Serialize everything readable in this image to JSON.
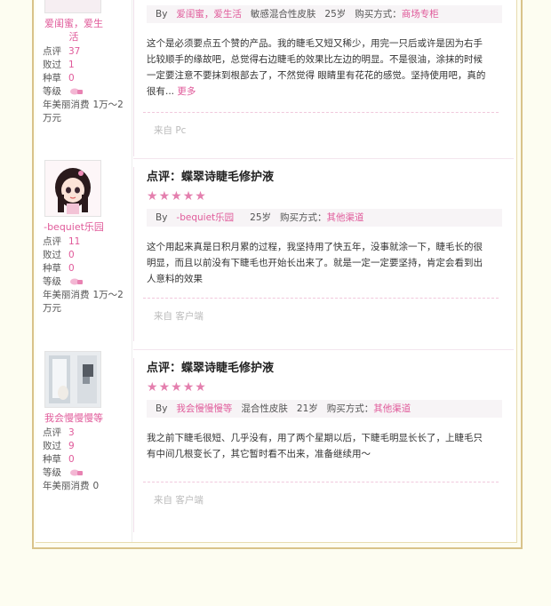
{
  "colors": {
    "accent": "#e05a9a",
    "frame": "#d9c38a",
    "star": "#e47fae"
  },
  "reviews": [
    {
      "username": "爱闺蜜，爱生活",
      "stats": {
        "points_label": "点评",
        "points": "37",
        "fail_label": "败过",
        "fail": "1",
        "grass_label": "种草",
        "grass": "0",
        "level_label": "等级",
        "spend_label": "年美丽消费",
        "spend": "1万～2万元"
      },
      "meta": {
        "by": "By",
        "user": "爱闺蜜，爱生活",
        "skin": "敏感混合性皮肤",
        "age": "25岁",
        "buy_label": "购买方式：",
        "buy": "商场专柜"
      },
      "body": "这个是必须要点五个赞的产品。我的睫毛又短又稀少，用完一只后或许是因为右手比较顺手的缘故吧，总觉得右边睫毛的效果比左边的明显。不是很油，涂抹的时候一定要注意不要抹到根部去了，不然觉得 眼睛里有花花的感觉。坚持使用吧，真的很有...",
      "more": "更多",
      "source": "来自 Pc"
    },
    {
      "username": "-bequiet乐园",
      "title": "点评：蝶翠诗睫毛修护液",
      "stats": {
        "points_label": "点评",
        "points": "11",
        "fail_label": "败过",
        "fail": "0",
        "grass_label": "种草",
        "grass": "0",
        "level_label": "等级",
        "spend_label": "年美丽消费",
        "spend": "1万～2万元"
      },
      "meta": {
        "by": "By",
        "user": "-bequiet乐园",
        "age": "25岁",
        "buy_label": "购买方式：",
        "buy": "其他渠道"
      },
      "body": "这个用起来真是日积月累的过程，我坚持用了快五年，没事就涂一下，睫毛长的很明显，而且以前没有下睫毛也开始长出来了。就是一定一定要坚持，肯定会看到出人意料的效果",
      "source": "来自 客户端"
    },
    {
      "username": "我会慢慢慢等",
      "title": "点评：蝶翠诗睫毛修护液",
      "stats": {
        "points_label": "点评",
        "points": "3",
        "fail_label": "败过",
        "fail": "9",
        "grass_label": "种草",
        "grass": "0",
        "level_label": "等级",
        "spend_label": "年美丽消费",
        "spend": "0"
      },
      "meta": {
        "by": "By",
        "user": "我会慢慢慢等",
        "skin": "混合性皮肤",
        "age": "21岁",
        "buy_label": "购买方式：",
        "buy": "其他渠道"
      },
      "body": "我之前下睫毛很短、几乎没有，用了两个星期以后，下睫毛明显长长了，上睫毛只有中间几根变长了，其它暂时看不出来，准备继续用～",
      "source": "来自 客户端"
    }
  ]
}
